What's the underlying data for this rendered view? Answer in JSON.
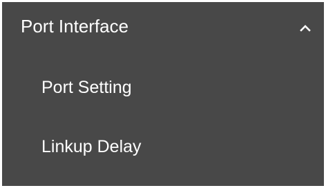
{
  "menu": {
    "group_title": "Port Interface",
    "expanded": true,
    "items": [
      {
        "label": "Port Setting"
      },
      {
        "label": "Linkup Delay"
      }
    ]
  },
  "colors": {
    "panel_background": "#484848",
    "text": "#ffffff"
  },
  "icons": {
    "toggle": "chevron-up-icon"
  }
}
